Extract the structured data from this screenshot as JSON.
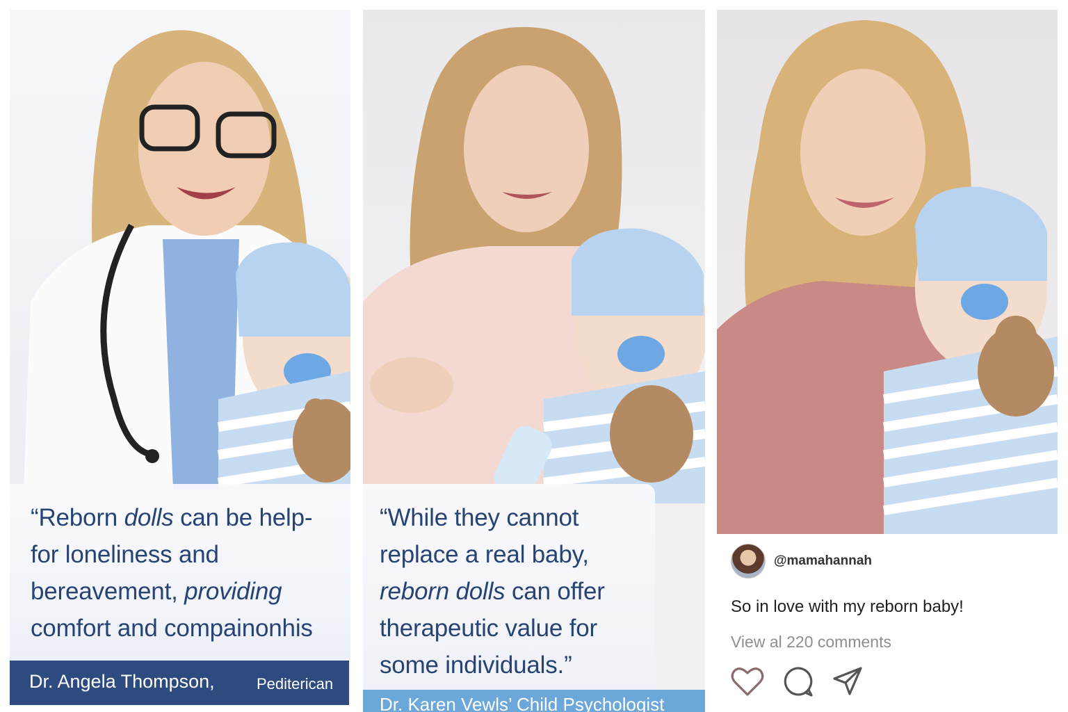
{
  "panels": [
    {
      "quote_lines": [
        [
          {
            "t": "“Reborn ",
            "i": false
          },
          {
            "t": "dolls",
            "i": true
          },
          {
            "t": " can be help-",
            "i": false
          }
        ],
        [
          {
            "t": "for loneliness and",
            "i": false
          }
        ],
        [
          {
            "t": "bereavement, ",
            "i": false
          },
          {
            "t": "providing",
            "i": true
          }
        ],
        [
          {
            "t": "comfort and compainonhis",
            "i": false
          }
        ]
      ],
      "attribution_name": "Dr. Angela Thompson,",
      "attribution_role": "Pediterican"
    },
    {
      "quote_lines": [
        [
          {
            "t": "“While they cannot",
            "i": false
          }
        ],
        [
          {
            "t": "replace a real baby,",
            "i": false
          }
        ],
        [
          {
            "t": "reborn dolls",
            "i": true
          },
          {
            "t": " can offer",
            "i": false
          }
        ],
        [
          {
            "t": "therapeutic value for",
            "i": false
          }
        ],
        [
          {
            "t": "some individuals.”",
            "i": false
          }
        ]
      ],
      "attribution": "Dr. Karen Vewls’ Child Psychologist"
    },
    {
      "post": {
        "handle": "@mamahannah",
        "caption": "So in love with my reborn baby!",
        "comments_link": "View al 220 comments"
      }
    }
  ],
  "icons": {
    "like": "heart-icon",
    "comment": "comment-bubble-icon",
    "share": "send-paper-plane-icon"
  },
  "colors": {
    "quote_text": "#274373",
    "attribution_bar_1": "#2d4b7e",
    "attribution_bar_2": "#6ba7d8"
  }
}
